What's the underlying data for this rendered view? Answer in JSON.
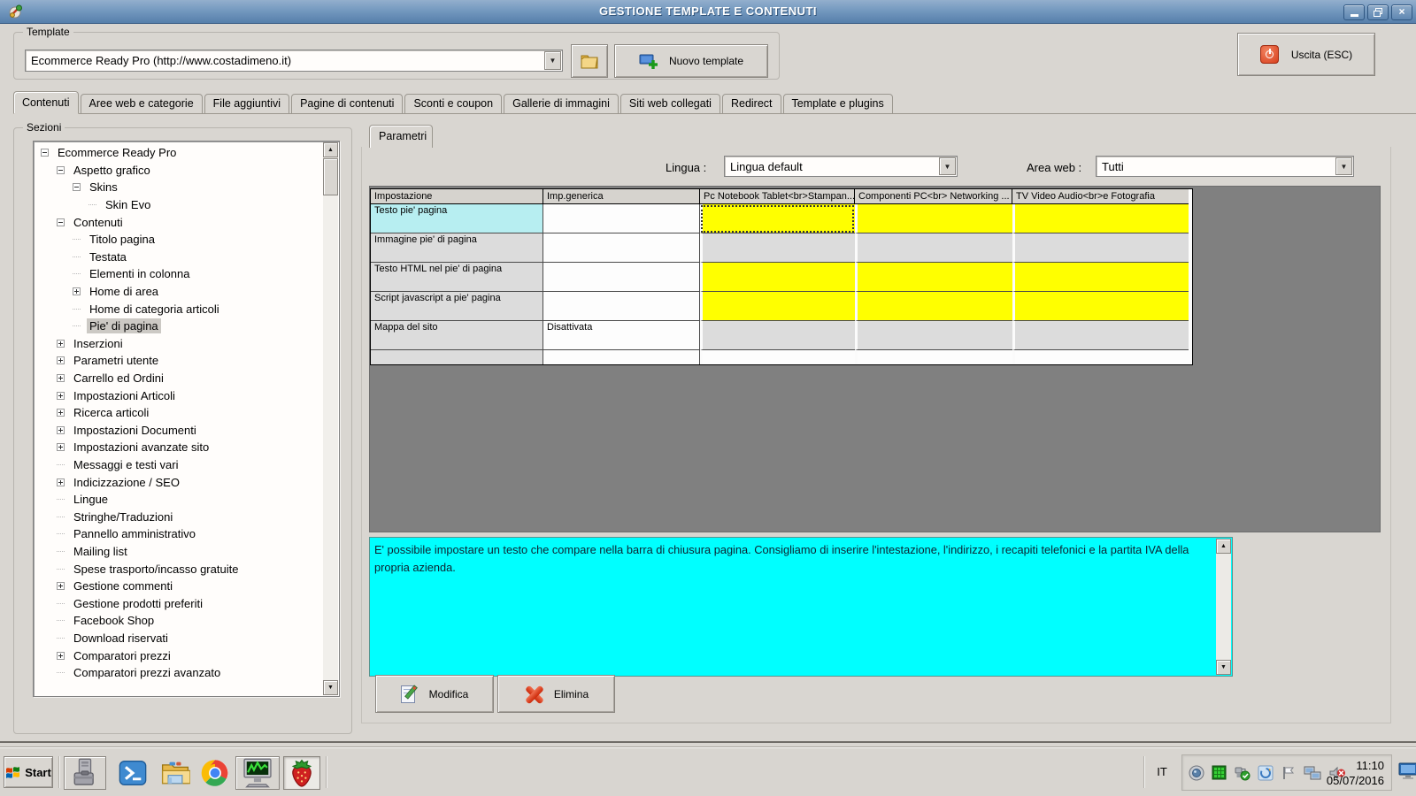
{
  "window": {
    "title": "GESTIONE TEMPLATE E CONTENUTI",
    "controls": {
      "minimize": "minimize",
      "restore": "restore",
      "close": "close"
    }
  },
  "template_box": {
    "label": "Template",
    "combo_value": "Ecommerce Ready Pro (http://www.costadimeno.it)",
    "new_button": "Nuovo template",
    "exit_button": "Uscita (ESC)"
  },
  "tabs": [
    "Contenuti",
    "Aree web e categorie",
    "File aggiuntivi",
    "Pagine di contenuti",
    "Sconti e coupon",
    "Gallerie di immagini",
    "Siti web collegati",
    "Redirect",
    "Template e plugins"
  ],
  "active_tab": "Contenuti",
  "sezioni": {
    "label": "Sezioni",
    "tree": [
      {
        "label": "Ecommerce Ready Pro",
        "level": 0,
        "state": "minus"
      },
      {
        "label": "Aspetto grafico",
        "level": 1,
        "state": "minus"
      },
      {
        "label": "Skins",
        "level": 2,
        "state": "minus"
      },
      {
        "label": "Skin Evo",
        "level": 3,
        "state": "leaf"
      },
      {
        "label": "Contenuti",
        "level": 1,
        "state": "minus"
      },
      {
        "label": "Titolo pagina",
        "level": 2,
        "state": "leaf"
      },
      {
        "label": "Testata",
        "level": 2,
        "state": "leaf"
      },
      {
        "label": "Elementi in colonna",
        "level": 2,
        "state": "leaf"
      },
      {
        "label": "Home di area",
        "level": 2,
        "state": "plus"
      },
      {
        "label": "Home di categoria articoli",
        "level": 2,
        "state": "leaf"
      },
      {
        "label": "Pie' di pagina",
        "level": 2,
        "state": "leaf",
        "selected": true
      },
      {
        "label": "Inserzioni",
        "level": 1,
        "state": "plus"
      },
      {
        "label": "Parametri utente",
        "level": 1,
        "state": "plus"
      },
      {
        "label": "Carrello ed Ordini",
        "level": 1,
        "state": "plus"
      },
      {
        "label": "Impostazioni Articoli",
        "level": 1,
        "state": "plus"
      },
      {
        "label": "Ricerca articoli",
        "level": 1,
        "state": "plus"
      },
      {
        "label": "Impostazioni Documenti",
        "level": 1,
        "state": "plus"
      },
      {
        "label": "Impostazioni avanzate sito",
        "level": 1,
        "state": "plus"
      },
      {
        "label": "Messaggi e testi vari",
        "level": 1,
        "state": "leaf"
      },
      {
        "label": "Indicizzazione / SEO",
        "level": 1,
        "state": "plus"
      },
      {
        "label": "Lingue",
        "level": 1,
        "state": "leaf"
      },
      {
        "label": "Stringhe/Traduzioni",
        "level": 1,
        "state": "leaf"
      },
      {
        "label": "Pannello amministrativo",
        "level": 1,
        "state": "leaf"
      },
      {
        "label": "Mailing list",
        "level": 1,
        "state": "leaf"
      },
      {
        "label": "Spese trasporto/incasso gratuite",
        "level": 1,
        "state": "leaf"
      },
      {
        "label": "Gestione commenti",
        "level": 1,
        "state": "plus"
      },
      {
        "label": "Gestione prodotti preferiti",
        "level": 1,
        "state": "leaf"
      },
      {
        "label": "Facebook Shop",
        "level": 1,
        "state": "leaf"
      },
      {
        "label": "Download riservati",
        "level": 1,
        "state": "leaf"
      },
      {
        "label": "Comparatori prezzi",
        "level": 1,
        "state": "plus"
      },
      {
        "label": "Comparatori prezzi avanzato",
        "level": 1,
        "state": "leaf"
      }
    ]
  },
  "parametri": {
    "tab_label": "Parametri",
    "lingua_label": "Lingua :",
    "lingua_value": "Lingua default",
    "area_label": "Area web :",
    "area_value": "Tutti",
    "grid": {
      "columns": [
        "Impostazione",
        "Imp.generica",
        "Pc Notebook Tablet<br>Stampan...",
        "Componenti PC<br> Networking ...",
        "TV Video Audio<br>e Fotografia"
      ],
      "rows": [
        {
          "label": "Testo pie' pagina",
          "generic": "",
          "cells": [
            "yellow",
            "yellow",
            "yellow"
          ],
          "selected": true,
          "focus_cell": 0
        },
        {
          "label": "Immagine pie' di pagina",
          "generic": "",
          "cells": [
            "gray",
            "gray",
            "gray"
          ]
        },
        {
          "label": "Testo HTML nel pie' di pagina",
          "generic": "",
          "cells": [
            "yellow",
            "yellow",
            "yellow"
          ]
        },
        {
          "label": "Script javascript a pie' pagina",
          "generic": "",
          "cells": [
            "yellow",
            "yellow",
            "yellow"
          ]
        },
        {
          "label": "Mappa del sito",
          "generic": "Disattivata",
          "cells": [
            "gray",
            "gray",
            "gray"
          ]
        },
        {
          "label": "",
          "generic": "",
          "cells": [
            "white",
            "white",
            "white"
          ],
          "short": true
        }
      ]
    },
    "description": "E' possibile impostare un testo che compare nella barra di chiusura pagina. Consigliamo di inserire l'intestazione, l'indirizzo, i recapiti telefonici e la partita IVA della propria azienda.",
    "modify_button": "Modifica",
    "delete_button": "Elimina"
  },
  "taskbar": {
    "start_label": "Start",
    "quick_launch": [
      {
        "icon": "system-tools",
        "style": "raised"
      },
      {
        "icon": "powershell",
        "style": "flat"
      },
      {
        "icon": "file-explorer",
        "style": "flat"
      },
      {
        "icon": "chrome",
        "style": "flat"
      },
      {
        "icon": "system-monitor",
        "style": "raised"
      },
      {
        "icon": "strawberry-app",
        "style": "pressed"
      }
    ],
    "tray": {
      "language": "IT",
      "icons": [
        "display",
        "network-activity",
        "usb-eject",
        "windows-update",
        "action-center-flag",
        "network-connection",
        "volume-muted"
      ],
      "time": "11:10",
      "date": "05/07/2016"
    }
  },
  "colors": {
    "window_bg": "#d9d6d1",
    "titlebar_top": "#93afcd",
    "titlebar_bottom": "#567fab",
    "grid_area_gray": "#808080",
    "cell_yellow": "#ffff00",
    "selected_label_cyan": "#b7eef1",
    "memo_cyan": "#00ffff"
  }
}
